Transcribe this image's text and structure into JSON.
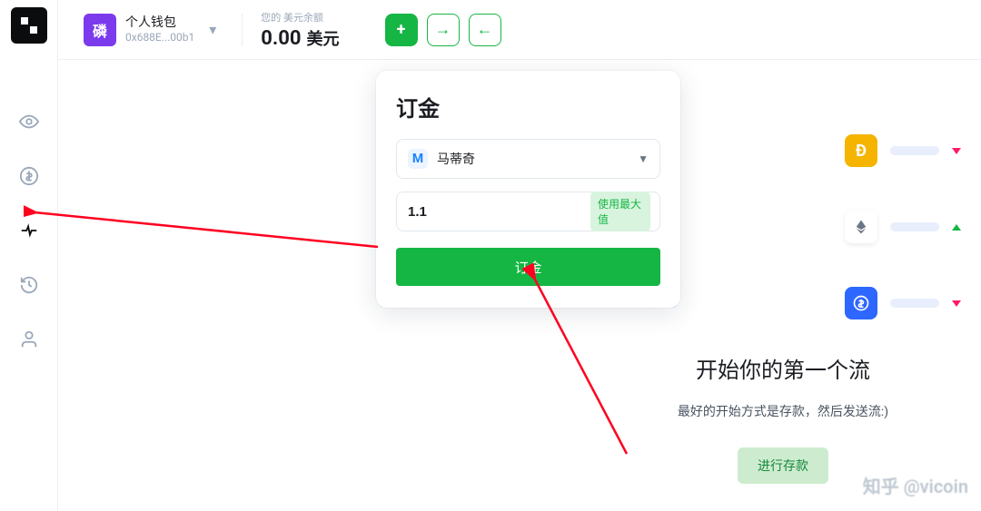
{
  "header": {
    "wallet": {
      "avatar_char": "磷",
      "name": "个人钱包",
      "address_short": "0x688E...00b1"
    },
    "balance_label": "您的 美元余额",
    "balance_value": "0.00",
    "balance_unit": "美元"
  },
  "modal": {
    "title": "订金",
    "network_label": "马蒂奇",
    "amount_value": "1.1",
    "max_label": "使用最大值",
    "submit_label": "订金"
  },
  "cta": {
    "title": "开始你的第一个流",
    "subtitle": "最好的开始方式是存款，然后发送流:)",
    "button": "进行存款"
  },
  "watermark": "知乎 @vicoin"
}
